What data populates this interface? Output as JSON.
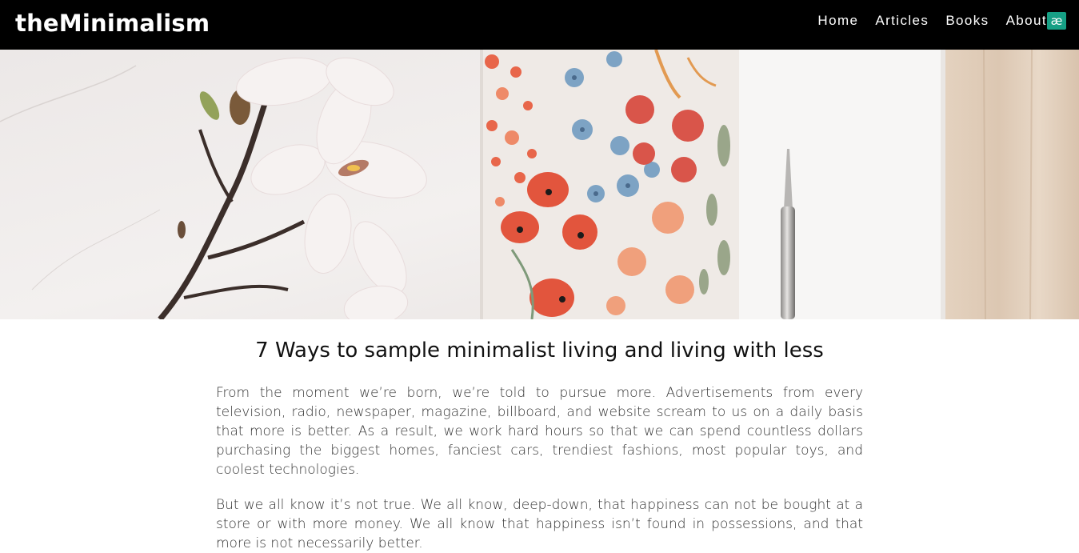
{
  "header": {
    "brand": "theMinimalism",
    "nav": [
      {
        "label": "Home"
      },
      {
        "label": "Articles"
      },
      {
        "label": "Books"
      },
      {
        "label": "About"
      }
    ],
    "badge_text": "æ",
    "badge_color": "#16a085"
  },
  "hero": {
    "image_icon": "hero-photo-flowers-notebook-pen"
  },
  "article": {
    "title": "7 Ways to sample minimalist living and living with less",
    "paragraphs": [
      "From the moment we’re born, we’re told to pursue more. Advertisements from every television, radio, newspaper, magazine, billboard, and website scream to us on a daily basis that more is better. As a result, we work hard hours so that we can spend countless dollars purchasing the biggest homes, fanciest cars, trendiest fashions, most popular toys, and coolest technologies.",
      "But we all know it’s not true. We all know, deep-down, that happiness can not be bought at a store or with more money. We all know that happiness isn’t found in possessions, and that more is not necessarily better."
    ]
  },
  "colors": {
    "navbar_bg": "#000000",
    "text": "#333333"
  }
}
